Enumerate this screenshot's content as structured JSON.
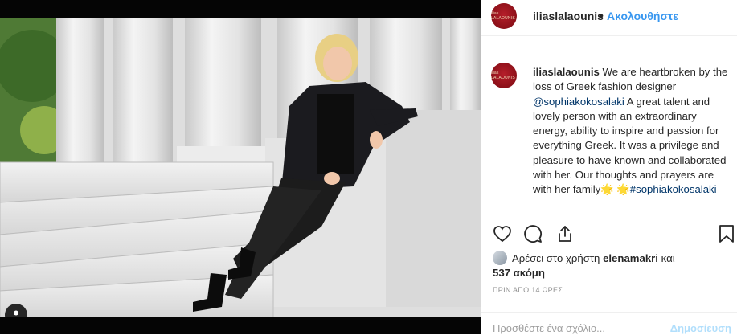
{
  "account": {
    "username": "iliaslalaounis",
    "avatar_text": "ilias LALAOUNIS",
    "follow_separator": "•",
    "follow_label": "Ακολουθήστε"
  },
  "caption": {
    "username": "iliaslalaounis",
    "text_part1": " We are heartbroken by the loss of Greek fashion designer ",
    "mention": "@sophiakokosalaki",
    "text_part2": " A great talent and lovely person with an extraordinary energy, ability to inspire and passion for everything Greek. It was a privilege and pleasure to have known and collaborated with her. Our thoughts and prayers are with her family",
    "emoji": "🌟 🌟",
    "hashtag": "#sophiakokosalaki"
  },
  "actions": {
    "like_icon": "heart-icon",
    "comment_icon": "comment-icon",
    "share_icon": "share-icon",
    "save_icon": "bookmark-icon"
  },
  "likes": {
    "prefix": "Αρέσει στο χρήστη ",
    "user": "elenamakri",
    "connector": " και",
    "count": "537 ακόμη"
  },
  "timestamp": "ΠΡΙΝ ΑΠΟ 14 ΩΡΕΣ",
  "comment": {
    "placeholder": "Προσθέστε ένα σχόλιο...",
    "post_label": "Δημοσίευση"
  },
  "colors": {
    "link": "#003569",
    "follow": "#3897f0",
    "post_disabled": "#b2dffc",
    "avatar": "#8c1019"
  }
}
